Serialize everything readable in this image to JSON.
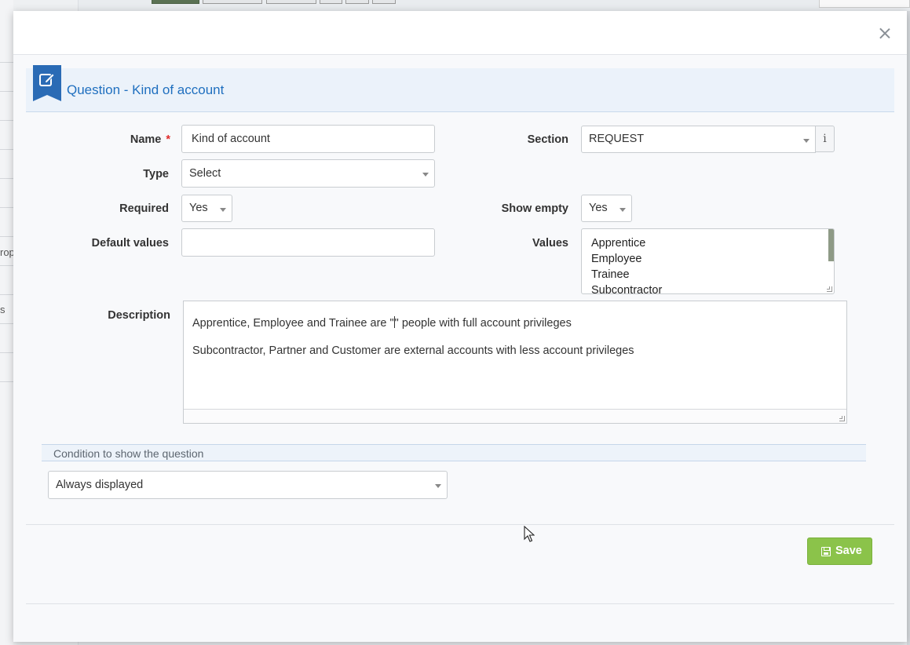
{
  "background": {
    "partial_texts": [
      "rop",
      "s"
    ]
  },
  "modal": {
    "title": "Question - Kind of account",
    "close_label": "×"
  },
  "form": {
    "name": {
      "label": "Name",
      "required_mark": "*",
      "value": "Kind of account"
    },
    "type": {
      "label": "Type",
      "value": "Select"
    },
    "required": {
      "label": "Required",
      "value": "Yes"
    },
    "default_values": {
      "label": "Default values",
      "value": ""
    },
    "section": {
      "label": "Section",
      "value": "REQUEST",
      "info_label": "i"
    },
    "show_empty": {
      "label": "Show empty",
      "value": "Yes"
    },
    "values": {
      "label": "Values",
      "options": [
        "Apprentice",
        "Employee",
        "Trainee",
        "Subcontractor"
      ]
    },
    "description": {
      "label": "Description",
      "line1_before": "Apprentice, Employee and Trainee are \"",
      "line1_after": "\" people with full account privileges",
      "line2": "Subcontractor, Partner and Customer are external accounts with less account privileges"
    }
  },
  "condition": {
    "heading": "Condition to show the question",
    "value": "Always displayed"
  },
  "actions": {
    "save_label": "Save"
  },
  "colors": {
    "accent": "#1f6fbf",
    "save": "#8bc34a",
    "required": "#e02b2b"
  }
}
